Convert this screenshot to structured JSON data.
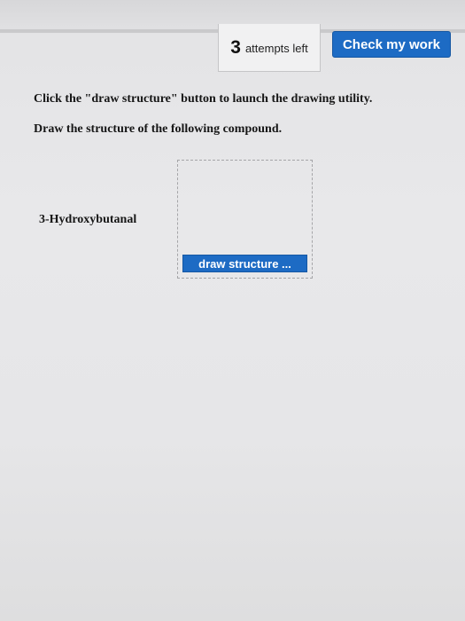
{
  "header": {
    "attempts_count": "3",
    "attempts_label": "attempts left",
    "check_button_label": "Check my work"
  },
  "question": {
    "instruction_launch": "Click the \"draw structure\" button to launch the drawing utility.",
    "instruction_draw": "Draw the structure of the following compound.",
    "compound_name": "3-Hydroxybutanal",
    "draw_button_label": "draw structure ..."
  },
  "colors": {
    "accent_blue": "#1d6bc4",
    "page_background": "#e6e6e8"
  }
}
